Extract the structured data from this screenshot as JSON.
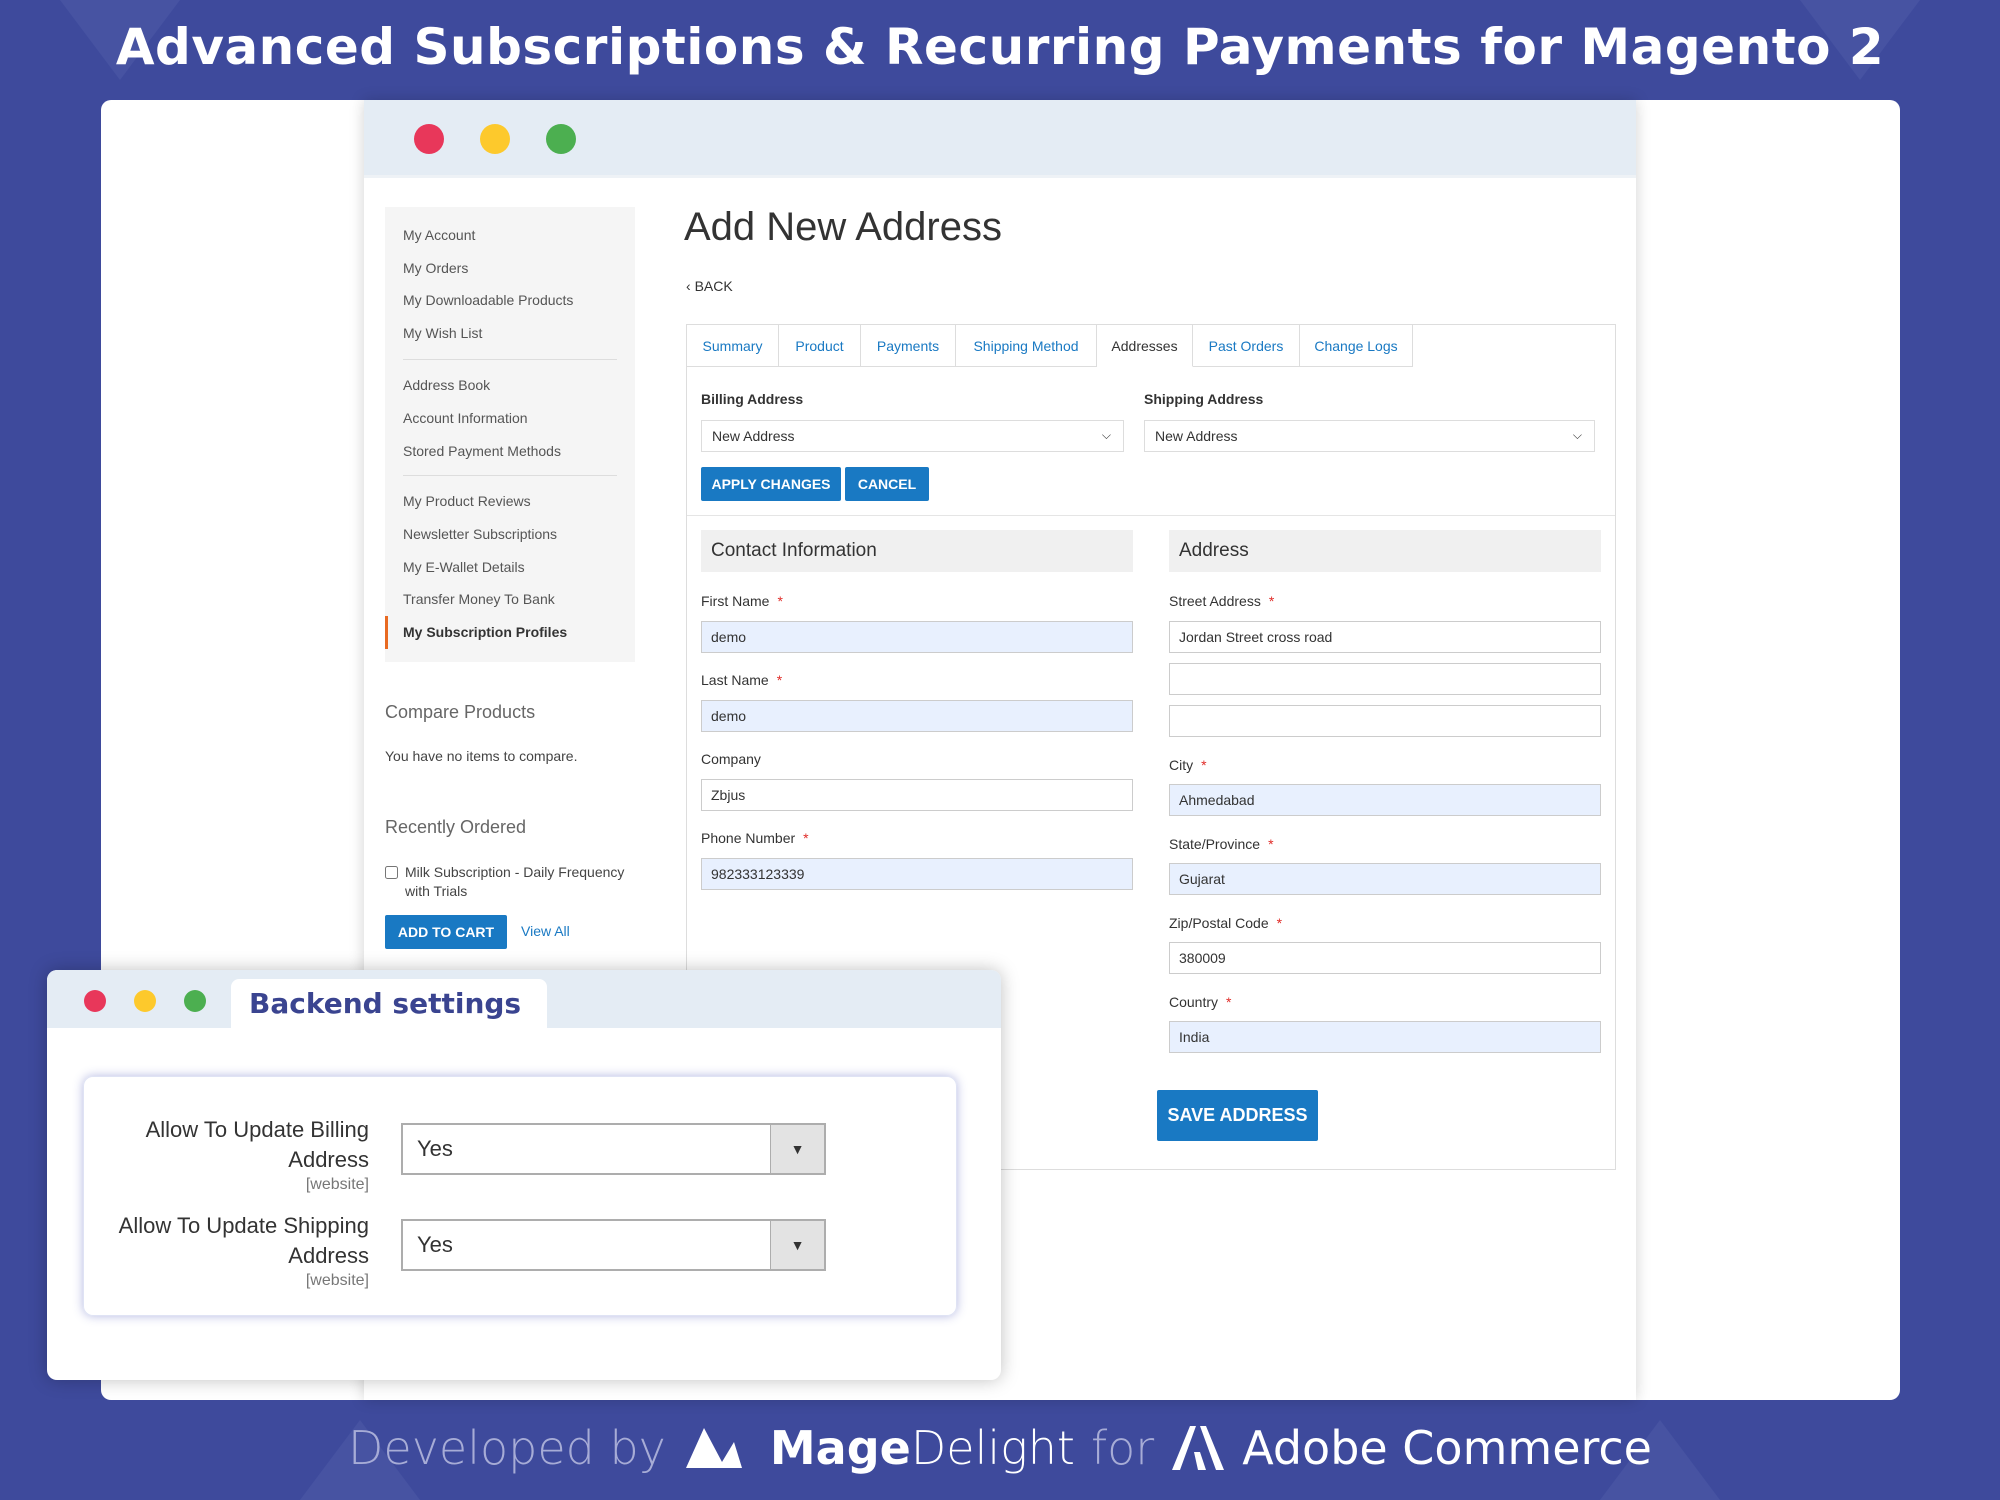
{
  "headline": "Advanced Subscriptions & Recurring Payments for Magento 2",
  "colors": {
    "background": "#3e4a9c",
    "accent": "#1979c3",
    "active_marker": "#e86a22",
    "required": "#e02b27"
  },
  "window_controls": [
    "close",
    "minimize",
    "maximize"
  ],
  "sidebar": {
    "groups": [
      [
        "My Account",
        "My Orders",
        "My Downloadable Products",
        "My Wish List"
      ],
      [
        "Address Book",
        "Account Information",
        "Stored Payment Methods"
      ],
      [
        "My Product Reviews",
        "Newsletter Subscriptions",
        "My E-Wallet Details",
        "Transfer Money To Bank",
        "My Subscription Profiles"
      ]
    ],
    "active": "My Subscription Profiles",
    "compare": {
      "title": "Compare Products",
      "text": "You have no items to compare."
    },
    "recent": {
      "title": "Recently Ordered",
      "item": "Milk Subscription - Daily Frequency with Trials",
      "add_to_cart": "ADD TO CART",
      "view_all": "View All"
    }
  },
  "main": {
    "title": "Add New Address",
    "back": "BACK",
    "tabs": [
      "Summary",
      "Product",
      "Payments",
      "Shipping Method",
      "Addresses",
      "Past Orders",
      "Change Logs"
    ],
    "active_tab": "Addresses",
    "billing": {
      "label": "Billing Address",
      "value": "New Address"
    },
    "shipping": {
      "label": "Shipping Address",
      "value": "New Address"
    },
    "apply": "APPLY CHANGES",
    "cancel": "CANCEL",
    "contact": {
      "title": "Contact Information",
      "first_name": {
        "label": "First Name",
        "value": "demo"
      },
      "last_name": {
        "label": "Last Name",
        "value": "demo"
      },
      "company": {
        "label": "Company",
        "value": "Zbjus"
      },
      "phone": {
        "label": "Phone Number",
        "value": "982333123339"
      }
    },
    "address": {
      "title": "Address",
      "street": {
        "label": "Street Address",
        "lines": [
          "Jordan Street cross road",
          "",
          ""
        ]
      },
      "city": {
        "label": "City",
        "value": "Ahmedabad"
      },
      "state": {
        "label": "State/Province",
        "value": "Gujarat"
      },
      "zip": {
        "label": "Zip/Postal Code",
        "value": "380009"
      },
      "country": {
        "label": "Country",
        "value": "India"
      }
    },
    "save": "SAVE ADDRESS",
    "required_mark": "*"
  },
  "backend": {
    "tab": "Backend settings",
    "rows": [
      {
        "label": "Allow To Update Billing Address",
        "scope": "[website]",
        "value": "Yes"
      },
      {
        "label": "Allow To Update Shipping Address",
        "scope": "[website]",
        "value": "Yes"
      }
    ]
  },
  "footer": {
    "developed_by": "Developed by",
    "brand_bold": "Mage",
    "brand_light": "Delight",
    "for": "for",
    "platform": "Adobe Commerce"
  }
}
